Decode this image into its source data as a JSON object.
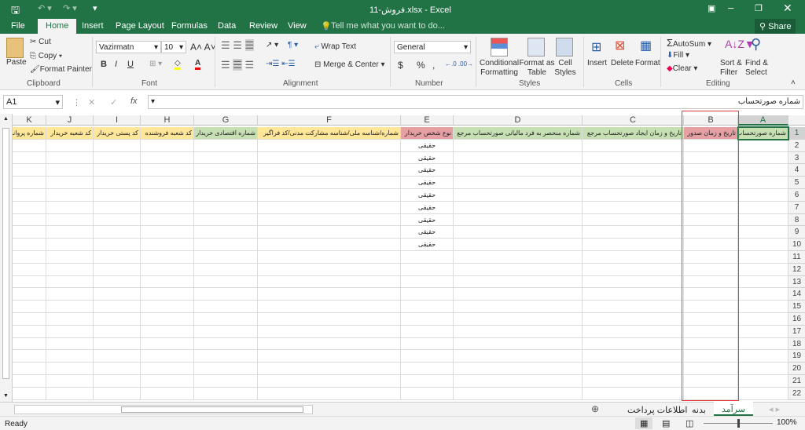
{
  "window": {
    "title": "فروش-11.xlsx - Excel"
  },
  "ribbon_tabs": [
    "File",
    "Home",
    "Insert",
    "Page Layout",
    "Formulas",
    "Data",
    "Review",
    "View"
  ],
  "tell_me": "Tell me what you want to do...",
  "share": "Share",
  "clipboard": {
    "paste": "Paste",
    "cut": "Cut",
    "copy": "Copy",
    "format_painter": "Format Painter",
    "label": "Clipboard"
  },
  "font": {
    "name": "Vazirmatn",
    "size": "10",
    "bold": "B",
    "italic": "I",
    "underline": "U",
    "label": "Font"
  },
  "alignment": {
    "wrap": "Wrap Text",
    "merge": "Merge & Center",
    "label": "Alignment"
  },
  "number": {
    "format": "General",
    "currency": "$",
    "percent": "%",
    "comma": ",",
    "label": "Number"
  },
  "styles": {
    "conditional": "Conditional Formatting",
    "format_table": "Format as Table",
    "cell_styles": "Cell Styles",
    "label": "Styles"
  },
  "cells": {
    "insert": "Insert",
    "delete": "Delete",
    "format": "Format",
    "label": "Cells"
  },
  "editing": {
    "autosum": "AutoSum",
    "fill": "Fill",
    "clear": "Clear",
    "sort": "Sort & Filter",
    "find": "Find & Select",
    "label": "Editing"
  },
  "formula_bar": {
    "name_box": "A1",
    "fx": "fx",
    "value": "شماره صورتحساب"
  },
  "columns": [
    "A",
    "B",
    "C",
    "D",
    "E",
    "F",
    "G",
    "H",
    "I",
    "J",
    "K"
  ],
  "header_row": [
    "شماره صورتحساب",
    "تاریخ و زمان صدور",
    "تاریخ و زمان ایجاد صورتحساب مرجع",
    "شماره منحصر به فرد مالیاتی صورتحساب مرجع",
    "نوع شخص خریدار",
    "شماره/شناسه ملی/شناسه مشارکت مدنی/کد فراگیر",
    "شماره اقتصادی خریدار",
    "کد شعبه فروشنده",
    "کد پستی خریدار",
    "کد شعبه خریدار",
    "شماره پروانه"
  ],
  "header_colors": [
    "#c6e0b4",
    "#e6a0a4",
    "#c6e0b4",
    "#c6e0b4",
    "#e6a0a4",
    "#ffe699",
    "#c6e0b4",
    "#ffe699",
    "#ffe699",
    "#ffe699",
    "#ffe699"
  ],
  "column_e_values": [
    "حقیقی",
    "حقیقی",
    "حقیقی",
    "حقیقی",
    "حقیقی",
    "حقیقی",
    "حقیقی",
    "حقیقی",
    "حقیقی"
  ],
  "row_count": 22,
  "highlight_color": "#e03c3c",
  "sheets": [
    {
      "name": "سرآمد",
      "active": true
    },
    {
      "name": "بدنه",
      "active": false
    },
    {
      "name": "اطلاعات پرداخت",
      "active": false
    }
  ],
  "status": {
    "ready": "Ready",
    "zoom": "100%"
  }
}
